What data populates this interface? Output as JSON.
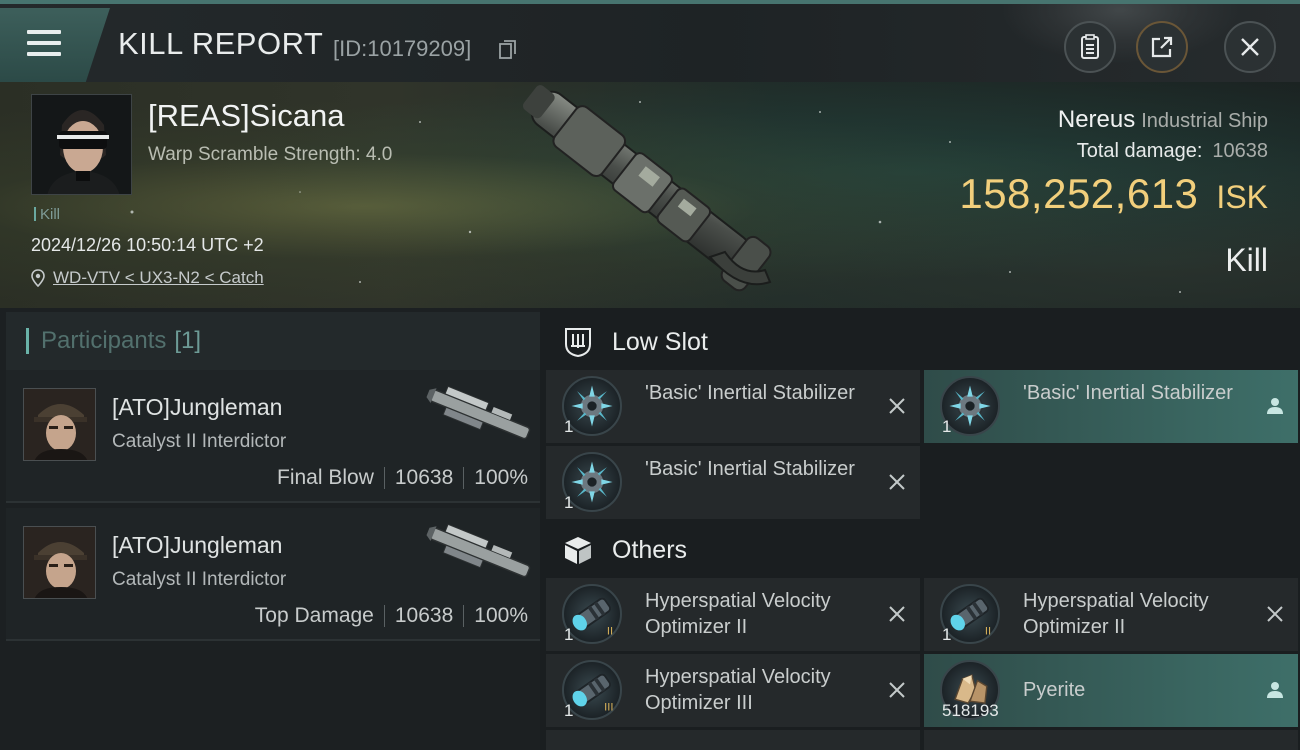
{
  "header": {
    "title": "KILL REPORT",
    "report_id": "[ID:10179209]"
  },
  "victim": {
    "name": "[REAS]Sicana",
    "warp_scramble": "Warp Scramble Strength: 4.0",
    "tag": "Kill",
    "datetime": "2024/12/26 10:50:14 UTC +2",
    "location": "WD-VTV < UX3-N2 < Catch",
    "ship_name": "Nereus",
    "ship_class": "Industrial Ship",
    "total_damage_label": "Total damage:",
    "total_damage": "10638",
    "isk_value": "158,252,613",
    "isk_unit": "ISK",
    "result": "Kill"
  },
  "participants": {
    "label": "Participants",
    "count": "[1]",
    "cards": [
      {
        "name": "[ATO]Jungleman",
        "ship": "Catalyst II Interdictor",
        "role": "Final Blow",
        "damage": "10638",
        "percent": "100%"
      },
      {
        "name": "[ATO]Jungleman",
        "ship": "Catalyst II Interdictor",
        "role": "Top Damage",
        "damage": "10638",
        "percent": "100%"
      }
    ]
  },
  "low_slot": {
    "label": "Low Slot",
    "items": [
      {
        "name": "'Basic' Inertial Stabilizer",
        "qty": "1",
        "icon": "inertial-stabilizer-icon",
        "action": "close-icon"
      },
      {
        "name": "'Basic' Inertial Stabilizer",
        "qty": "1",
        "icon": "inertial-stabilizer-icon",
        "action": "person-icon"
      },
      {
        "name": "'Basic' Inertial Stabilizer",
        "qty": "1",
        "icon": "inertial-stabilizer-icon",
        "action": "close-icon"
      }
    ]
  },
  "others": {
    "label": "Others",
    "items": [
      {
        "name": "Hyperspatial Velocity Optimizer II",
        "qty": "1",
        "icon": "velocity-optimizer-icon",
        "action": "close-icon"
      },
      {
        "name": "Hyperspatial Velocity Optimizer II",
        "qty": "1",
        "icon": "velocity-optimizer-icon",
        "action": "close-icon"
      },
      {
        "name": "Hyperspatial Velocity Optimizer III",
        "qty": "1",
        "icon": "velocity-optimizer-icon",
        "action": "close-icon"
      },
      {
        "name": "Pyerite",
        "qty": "518193",
        "icon": "pyerite-icon",
        "action": "person-icon"
      }
    ]
  },
  "colors": {
    "accent": "#47746f",
    "isk_gold": "#f2cf7c",
    "highlight": "#3e6f69"
  }
}
